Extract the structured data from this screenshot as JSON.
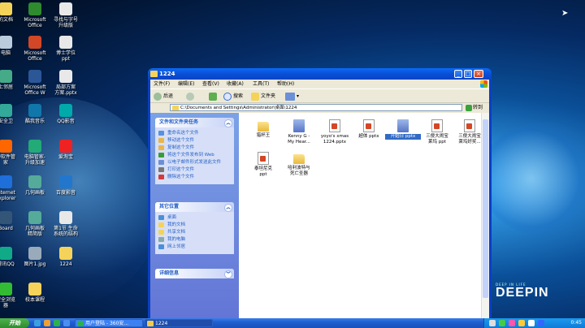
{
  "desktop": {
    "icons": [
      {
        "label": "的文档",
        "color": "#f5d35a"
      },
      {
        "label": "Microsoft\nOffice",
        "color": "#2e8b2e"
      },
      {
        "label": "寻找与字号\n升级版",
        "color": "#e8e8e8"
      },
      {
        "label": "电脑",
        "color": "#bcd"
      },
      {
        "label": "Microsoft\nOffice",
        "color": "#d24726"
      },
      {
        "label": "博士学位\nppt",
        "color": "#e8e8e8"
      },
      {
        "label": "上邻居",
        "color": "#4a8"
      },
      {
        "label": "Microsoft\nOffice W",
        "color": "#2b5797"
      },
      {
        "label": "局部方案\n方案.pptx",
        "color": "#e8e8e8"
      },
      {
        "label": "安全卫",
        "color": "#3a9"
      },
      {
        "label": "酷我音乐",
        "color": "#17a"
      },
      {
        "label": "QQ影音",
        "color": "#0aa"
      },
      {
        "label": "中软件管\n家",
        "color": "#f60"
      },
      {
        "label": "电脑管家-\n升级加速",
        "color": "#2a7"
      },
      {
        "label": "爱淘宝",
        "color": "#e22"
      },
      {
        "label": "Internet\nExplorer",
        "color": "#1e6fd9"
      },
      {
        "label": "几何画板",
        "color": "#5a9"
      },
      {
        "label": "百度影音",
        "color": "#27c"
      },
      {
        "label": "Board",
        "color": "#357"
      },
      {
        "label": "几何画板\n精简版",
        "color": "#5a9"
      },
      {
        "label": "第1节 生命\n系统的结构",
        "color": "#e8e8e8"
      },
      {
        "label": "腾讯QQ",
        "color": "#1a8"
      },
      {
        "label": "图片1.jpg",
        "color": "#9ab"
      },
      {
        "label": "1224",
        "color": "#f5d35a"
      },
      {
        "label": "安全浏览\n器",
        "color": "#3b3"
      },
      {
        "label": "校本课程",
        "color": "#f5d35a"
      }
    ],
    "brand": "DEEPIN",
    "brand_tagline": "DEEP IN LIFE"
  },
  "window": {
    "title": "1224",
    "menus": [
      "文件(F)",
      "编辑(E)",
      "查看(V)",
      "收藏(A)",
      "工具(T)",
      "帮助(H)"
    ],
    "toolbar": {
      "back": "后退",
      "search": "搜索",
      "folders": "文件夹"
    },
    "address": "C:\\Documents and Settings\\Administrator\\桌面\\1224",
    "go_label": "转到",
    "tasks_panel": {
      "title": "文件和文件夹任务",
      "items": [
        "重命名这个文件",
        "移动这个文件",
        "复制这个文件",
        "将这个文件发布到 Web",
        "以电子邮件形式发送此文件",
        "打印这个文件",
        "删除这个文件"
      ]
    },
    "places_panel": {
      "title": "其它位置",
      "items": [
        "桌面",
        "我的文档",
        "共享文档",
        "我的电脑",
        "网上邻居"
      ]
    },
    "details_panel": {
      "title": "详细信息"
    },
    "files": [
      {
        "name": "猎杯王",
        "type": "folder",
        "selected": false
      },
      {
        "name": "Kenny G -\nMy Hear...",
        "type": "exe",
        "selected": false
      },
      {
        "name": "yoyo's xmas\n1224.pptx",
        "type": "ppt",
        "selected": false
      },
      {
        "name": "超体 pptx",
        "type": "ppt",
        "selected": false
      },
      {
        "name": "开始日 pptx",
        "type": "exe",
        "selected": true
      },
      {
        "name": "三傻大闹宝\n莱坞 ppt",
        "type": "ppt",
        "selected": false
      },
      {
        "name": "三傻大闹宝\n莱坞好奖...",
        "type": "ppt",
        "selected": false
      },
      {
        "name": "泰坦尼克\nppt",
        "type": "ppt",
        "selected": false
      },
      {
        "name": "哈利波特与\n死亡圣器",
        "type": "folder",
        "selected": false
      }
    ]
  },
  "taskbar": {
    "start": "开始",
    "tasks": [
      {
        "label": "用户登陆 - 360安..."
      },
      {
        "label": "1224"
      }
    ],
    "clock": "0:45"
  }
}
